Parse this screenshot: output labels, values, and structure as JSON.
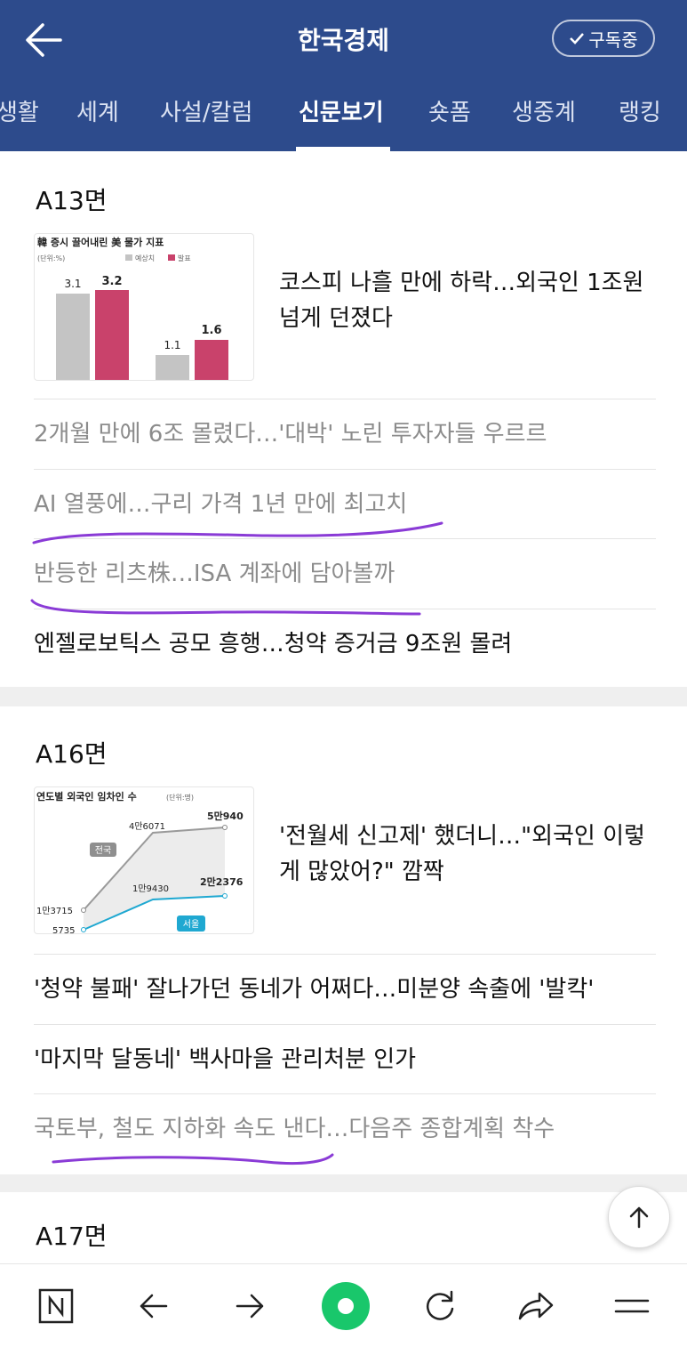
{
  "header": {
    "title": "한국경제",
    "subscribe_label": "구독중",
    "bg_color": "#2d4b8c"
  },
  "tabs": [
    {
      "label": "생활"
    },
    {
      "label": "세계"
    },
    {
      "label": "사설/칼럼"
    },
    {
      "label": "신문보기",
      "active": true
    },
    {
      "label": "숏폼"
    },
    {
      "label": "생중계"
    },
    {
      "label": "랭킹"
    }
  ],
  "sections": [
    {
      "title": "A13면",
      "lead": {
        "headline": "코스피 나흘 만에 하락…외국인 1조원 넘게 던졌다",
        "thumb": {
          "title": "韓 증시 끌어내린 美 물가 지표",
          "unit": "(단위:%)",
          "legend": [
            "예상치",
            "발표"
          ],
          "colors": [
            "#c4c4c4",
            "#c9426b"
          ],
          "groups": [
            {
              "expected": "3.1",
              "actual": "3.2"
            },
            {
              "expected": "1.1",
              "actual": "1.6"
            }
          ]
        }
      },
      "items": [
        {
          "text": "2개월 만에 6조 몰렸다…'대박' 노린 투자자들 우르르",
          "read": true
        },
        {
          "text": "AI 열풍에…구리 가격 1년 만에 최고치",
          "read": true
        },
        {
          "text": "반등한 리츠株…ISA 계좌에 담아볼까",
          "read": true
        },
        {
          "text": "엔젤로보틱스 공모 흥행…청약 증거금 9조원 몰려",
          "read": false
        }
      ]
    },
    {
      "title": "A16면",
      "lead": {
        "headline": "'전월세 신고제' 했더니…\"외국인 이렇게 많았어?\" 깜짝",
        "thumb": {
          "title": "연도별 외국인 임차인 수",
          "unit": "(단위:명)",
          "series": [
            {
              "name": "전국",
              "labels": [
                "1만3715",
                "4만6071",
                "5만940"
              ],
              "color": "#9a9a9a"
            },
            {
              "name": "서울",
              "labels": [
                "5735",
                "1만9430",
                "2만2376"
              ],
              "color": "#1fa8d1"
            }
          ]
        }
      },
      "items": [
        {
          "text": "'청약 불패' 잘나가던 동네가 어쩌다…미분양 속출에 '발칵'",
          "read": false
        },
        {
          "text": "'마지막 달동네' 백사마을 관리처분 인가",
          "read": false
        },
        {
          "text": "국토부, 철도 지하화 속도 낸다…다음주 종합계획 착수",
          "read": true
        }
      ]
    },
    {
      "title": "A17면"
    }
  ],
  "annotation_color": "#8a3bd6",
  "bottom_nav": [
    "naver-home-icon",
    "back-arrow-icon",
    "forward-arrow-icon",
    "green-dot-icon",
    "refresh-icon",
    "share-icon",
    "menu-icon"
  ],
  "accent_green": "#19c76b"
}
